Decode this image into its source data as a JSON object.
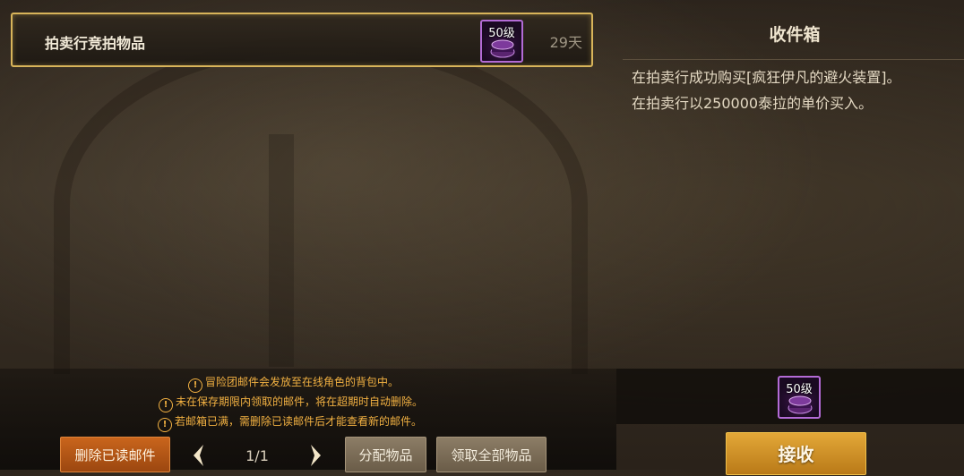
{
  "mail_list": {
    "items": [
      {
        "title": "拍卖行竞拍物品",
        "item_level": "50级",
        "days_left": "29天"
      }
    ]
  },
  "detail_panel": {
    "title": "收件箱",
    "body_lines": [
      "在拍卖行成功购买[疯狂伊凡的避火装置]。",
      "在拍卖行以250000泰拉的单价买入。"
    ],
    "attachment_level": "50级",
    "receive_label": "接收"
  },
  "notices": [
    "冒险团邮件会发放至在线角色的背包中。",
    "未在保存期限内领取的邮件，将在超期时自动删除。",
    "若邮箱已满，需删除已读邮件后才能查看新的邮件。"
  ],
  "footer": {
    "delete_read_label": "删除已读邮件",
    "page_indicator": "1/1",
    "assign_items_label": "分配物品",
    "claim_all_label": "领取全部物品"
  },
  "icons": {
    "warning": "warning-icon",
    "prev": "chevron-left-icon",
    "next": "chevron-right-icon",
    "item": "fire-device-item-icon"
  },
  "colors": {
    "accent_gold": "#d8b45a",
    "notice_orange": "#f2b142",
    "receive_button": "#e3a838",
    "delete_button": "#c9651c",
    "item_border_epic": "#b36bd6"
  }
}
